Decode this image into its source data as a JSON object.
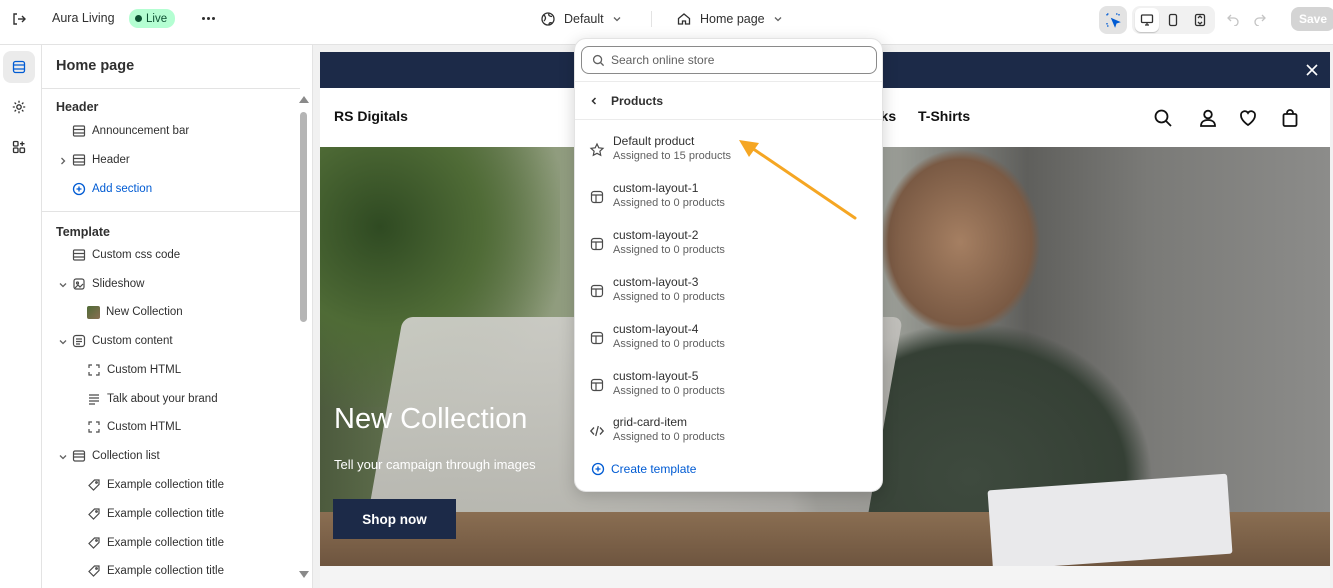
{
  "topbar": {
    "store_name": "Aura Living",
    "live_label": "Live",
    "theme_label": "Default",
    "page_label": "Home page",
    "save_label": "Save"
  },
  "sidebar": {
    "title": "Home page",
    "header_group": "Header",
    "header_items": [
      {
        "label": "Announcement bar"
      },
      {
        "label": "Header"
      },
      {
        "label": "Add section"
      }
    ],
    "template_group": "Template",
    "template_items": [
      {
        "label": "Custom css code"
      },
      {
        "label": "Slideshow"
      },
      {
        "label": "New Collection"
      },
      {
        "label": "Custom content"
      },
      {
        "label": "Custom HTML"
      },
      {
        "label": "Talk about your brand"
      },
      {
        "label": "Custom HTML"
      },
      {
        "label": "Collection list"
      },
      {
        "label": "Example collection title"
      },
      {
        "label": "Example collection title"
      },
      {
        "label": "Example collection title"
      },
      {
        "label": "Example collection title"
      }
    ]
  },
  "preview": {
    "logo": "RS Digitals",
    "nav_links": [
      "nks",
      "T-Shirts"
    ],
    "hero_title": "New Collection",
    "hero_subtitle": "Tell your campaign through images",
    "shop_button": "Shop now"
  },
  "dropdown": {
    "search_placeholder": "Search online store",
    "back_label": "Products",
    "items": [
      {
        "name": "Default product",
        "meta": "Assigned to 15 products",
        "icon": "star-icon"
      },
      {
        "name": "custom-layout-1",
        "meta": "Assigned to 0 products",
        "icon": "layout-icon"
      },
      {
        "name": "custom-layout-2",
        "meta": "Assigned to 0 products",
        "icon": "layout-icon"
      },
      {
        "name": "custom-layout-3",
        "meta": "Assigned to 0 products",
        "icon": "layout-icon"
      },
      {
        "name": "custom-layout-4",
        "meta": "Assigned to 0 products",
        "icon": "layout-icon"
      },
      {
        "name": "custom-layout-5",
        "meta": "Assigned to 0 products",
        "icon": "layout-icon"
      },
      {
        "name": "grid-card-item",
        "meta": "Assigned to 0 products",
        "icon": "code-icon"
      }
    ],
    "create_label": "Create template"
  },
  "colors": {
    "accent": "#005bd3",
    "live_bg": "#b4fed2",
    "brand_navy": "#1c2a48",
    "annotation_arrow": "#f5a623"
  }
}
